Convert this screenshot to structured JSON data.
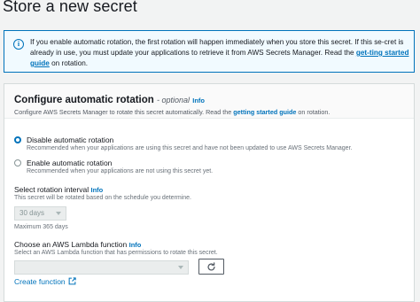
{
  "page": {
    "title": "Store a new secret"
  },
  "alert": {
    "text_before": "If you enable automatic rotation, the first rotation will happen immediately when you store this secret. If this se-cret is already in use, you must update your applications to retrieve it from AWS Secrets Manager. Read the ",
    "link": "get-ting started guide",
    "text_after": " on rotation."
  },
  "section": {
    "title": "Configure automatic rotation",
    "optional": "- optional",
    "info": "Info",
    "desc_before": "Configure AWS Secrets Manager to rotate this secret automatically. Read the ",
    "desc_link": "getting started guide",
    "desc_after": " on rotation.",
    "options": [
      {
        "label": "Disable automatic rotation",
        "desc": "Recommended when your applications are using this secret and have not been updated to use AWS Secrets Manager.",
        "selected": true
      },
      {
        "label": "Enable automatic rotation",
        "desc": "Recommended when your applications are not using this secret yet.",
        "selected": false
      }
    ],
    "interval": {
      "label": "Select rotation interval",
      "info": "Info",
      "desc": "This secret will be rotated based on the schedule you determine.",
      "value": "30 days",
      "hint": "Maximum 365 days"
    },
    "lambda": {
      "label": "Choose an AWS Lambda function",
      "info": "Info",
      "desc": "Select an AWS Lambda function that has permissions to rotate this secret.",
      "value": "",
      "refresh_icon": "refresh-icon",
      "create_link": "Create function",
      "external_icon": "external-link-icon"
    }
  },
  "colors": {
    "accent": "#0073bb",
    "alert_bg": "#f1faff",
    "page_bg": "#f2f3f3"
  }
}
